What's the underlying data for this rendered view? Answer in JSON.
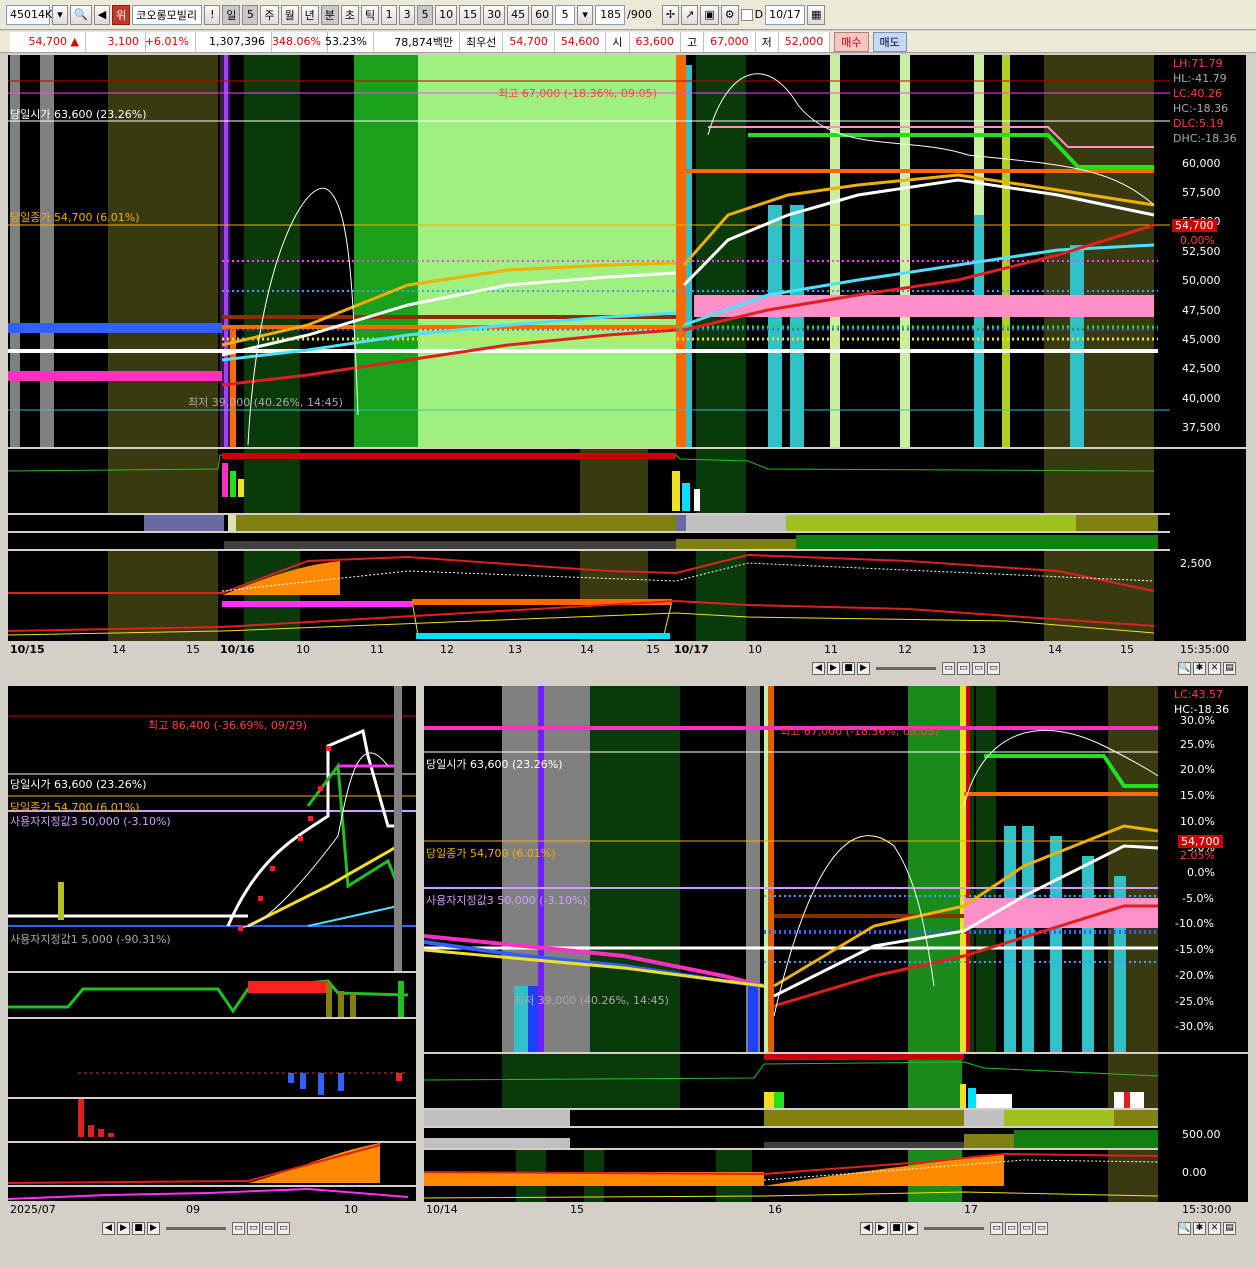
{
  "toolbar": {
    "code": "45014K",
    "badge": "위",
    "name": "코오롱모빌리",
    "bang": "!",
    "period_day": "일",
    "period_num": "5",
    "buttons": [
      "주",
      "월",
      "년",
      "분",
      "초",
      "틱",
      "1",
      "3",
      "5",
      "10",
      "15",
      "30",
      "45",
      "60"
    ],
    "interval": "5",
    "count": "185",
    "count_max": "/900",
    "d_label": "D",
    "date": "10/17"
  },
  "quote": {
    "price": "54,700",
    "arrow": "▲",
    "change": "3,100",
    "pct": "+6.01%",
    "volume": "1,307,396",
    "vol_ratio": "348.06%",
    "turnover_pct": "53.23%",
    "amount": "78,874백만",
    "pref_label": "최우선",
    "ask": "54,700",
    "bid": "54,600",
    "open_lbl": "시",
    "open": "63,600",
    "high_lbl": "고",
    "high": "67,000",
    "low_lbl": "저",
    "low": "52,000",
    "buy": "매수",
    "sell": "매도"
  },
  "top_chart": {
    "labels": {
      "max": "최고 67,000 (-18.36%, 09:05)",
      "open": "당일시가 63,600 (23.26%)",
      "close": "당일종가 54,700 (6.01%)",
      "low": "최저 39,000 (40.26%, 14:45)"
    },
    "right_info": [
      "LH:71.79",
      "HL:-41.79",
      "LC:40.26",
      "HC:-18.36",
      "DLC:5.19",
      "DHC:-18.36"
    ],
    "price_axis": [
      "60,000",
      "57,500",
      "55,000",
      "52,500",
      "50,000",
      "47,500",
      "45,000",
      "42,500",
      "40,000",
      "37,500"
    ],
    "last_price": "54,700",
    "last_pct": "0.00%",
    "sub_axis": "2,500",
    "time_right": "15:35:00",
    "x_labels": [
      "10/15",
      "14",
      "15",
      "10/16",
      "10",
      "11",
      "12",
      "13",
      "14",
      "15",
      "10/17",
      "10",
      "11",
      "12",
      "13",
      "14",
      "15"
    ]
  },
  "bottom_left": {
    "labels": {
      "max": "최고 86,400 (-36.69%, 09/29)",
      "open": "당일시가 63,600 (23.26%)",
      "close": "당일종가 54,700 (6.01%)",
      "user3": "사용자지정값3 50,000 (-3.10%)",
      "user1": "사용자지정값1 5,000 (-90.31%)"
    },
    "x_labels": [
      "2025/07",
      "09",
      "10"
    ]
  },
  "bottom_right": {
    "labels": {
      "max": "최고 67,000 (-18.36%, 09:05)",
      "open": "당일시가 63,600 (23.26%)",
      "close": "당일종가 54,700 (6.01%)",
      "user3": "사용자지정값3 50,000 (-3.10%)",
      "low": "최저 39,000 (40.26%, 14:45)"
    },
    "right_info": [
      "LC:43.57",
      "HC:-18.36"
    ],
    "pct_axis": [
      "30.0%",
      "25.0%",
      "20.0%",
      "15.0%",
      "10.0%",
      "5.0%",
      "0.0%",
      "-5.0%",
      "-10.0%",
      "-15.0%",
      "-20.0%",
      "-25.0%",
      "-30.0%"
    ],
    "last_price": "54,700",
    "last_pct": "2.05%",
    "sub_axis1": "500.00",
    "sub_axis2": "0.00",
    "time_right": "15:30:00",
    "x_labels": [
      "10/14",
      "15",
      "16",
      "17"
    ]
  }
}
